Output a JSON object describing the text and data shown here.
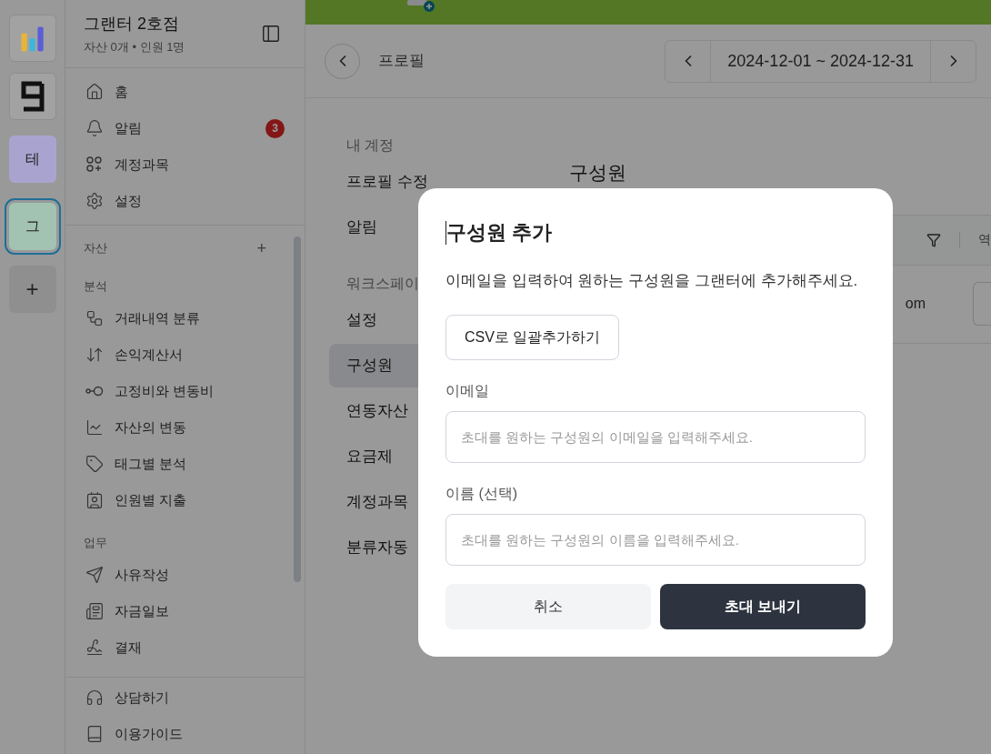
{
  "rail": [
    {
      "kind": "chart"
    },
    {
      "kind": "glyph"
    },
    {
      "kind": "workspace",
      "label": "테",
      "color": "#a9a4cf",
      "selected": false
    },
    {
      "kind": "workspace",
      "label": "그",
      "color": "#a2c2b2",
      "selected": true
    },
    {
      "kind": "add",
      "label": "+"
    }
  ],
  "sidebar": {
    "title": "그랜터 2호점",
    "subtitle": "자산 0개 • 인원 1명",
    "nav": [
      {
        "label": "홈"
      },
      {
        "label": "알림",
        "badge": "3"
      },
      {
        "label": "계정과목"
      },
      {
        "label": "설정"
      }
    ],
    "sections": [
      {
        "title": "자산",
        "action": "+"
      },
      {
        "title": "분석",
        "items": [
          {
            "label": "거래내역 분류"
          },
          {
            "label": "손익계산서"
          },
          {
            "label": "고정비와 변동비"
          },
          {
            "label": "자산의 변동"
          },
          {
            "label": "태그별 분석"
          },
          {
            "label": "인원별 지출"
          }
        ]
      },
      {
        "title": "업무",
        "items": [
          {
            "label": "사유작성"
          },
          {
            "label": "자금일보"
          },
          {
            "label": "결재"
          }
        ]
      }
    ],
    "footer": [
      {
        "label": "상담하기"
      },
      {
        "label": "이용가이드"
      }
    ]
  },
  "header": {
    "title": "프로필",
    "date_range": "2024-12-01 ~ 2024-12-31"
  },
  "settings_nav": [
    {
      "title": "내 계정",
      "items": [
        {
          "label": "프로필 수정",
          "selected": false
        },
        {
          "label": "알림",
          "selected": false
        }
      ]
    },
    {
      "title": "워크스페이",
      "items": [
        {
          "label": "설정",
          "selected": false
        },
        {
          "label": "구성원",
          "selected": true
        },
        {
          "label": "연동자산",
          "selected": false
        },
        {
          "label": "요금제",
          "selected": false
        },
        {
          "label": "계정과목",
          "selected": false
        },
        {
          "label": "분류자동",
          "selected": false
        }
      ]
    }
  ],
  "content": {
    "title": "구성원",
    "table": {
      "header_text": "역",
      "row_text": "om"
    }
  },
  "dialog": {
    "title": "구성원 추가",
    "description": "이메일을 입력하여 원하는 구성원을 그랜터에 추가해주세요.",
    "csv_button": "CSV로 일괄추가하기",
    "fields": [
      {
        "label": "이메일",
        "placeholder": "초대를 원하는 구성원의 이메일을 입력해주세요."
      },
      {
        "label": "이름 (선택)",
        "placeholder": "초대를 원하는 구성원의 이름을 입력해주세요."
      }
    ],
    "buttons": [
      {
        "label": "취소",
        "kind": "secondary"
      },
      {
        "label": "초대 보내기",
        "kind": "primary"
      }
    ]
  }
}
